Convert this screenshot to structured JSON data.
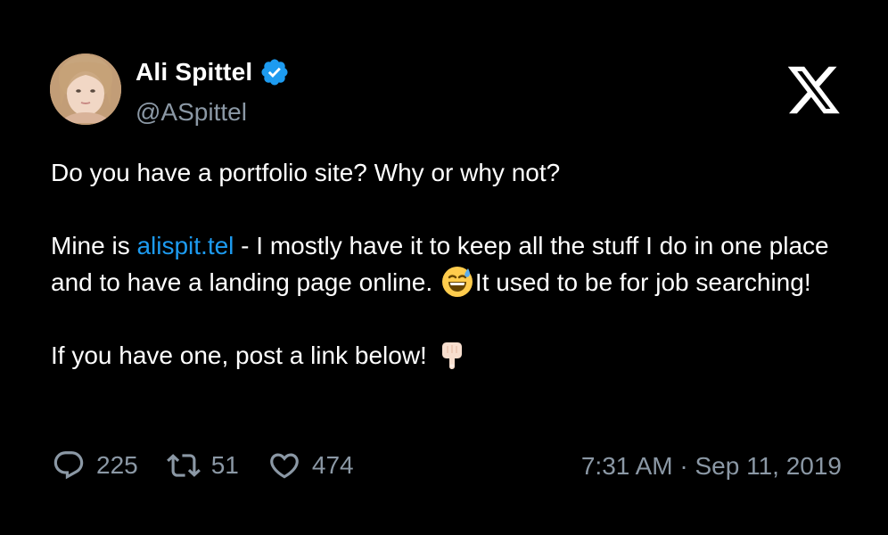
{
  "author": {
    "name": "Ali Spittel",
    "handle": "@ASpittel",
    "verified": true
  },
  "icons": {
    "avatar": "profile-photo",
    "verified": "verified-badge-icon",
    "brand": "x-logo-icon",
    "reply": "reply-icon",
    "retweet": "retweet-icon",
    "like": "like-icon",
    "emoji_sweat": "grinning-face-with-sweat-emoji",
    "emoji_point": "backhand-index-pointing-down-emoji"
  },
  "tweet": {
    "line1": "Do you have a portfolio site? Why or why not?",
    "line2_prefix": "Mine is ",
    "link": "alispit.tel",
    "line2_after_link": " - I mostly have it to keep all the stuff I do in one place and to have a landing page online. ",
    "line2_suffix": "It used to be for job searching!",
    "line3": "If you have one, post a link below! "
  },
  "stats": {
    "replies": "225",
    "retweets": "51",
    "likes": "474"
  },
  "timestamp": "7:31 AM · Sep 11, 2019",
  "colors": {
    "background": "#000000",
    "text": "#ffffff",
    "muted": "#8b98a5",
    "link": "#1d9bf0",
    "verified": "#1d9bf0"
  }
}
